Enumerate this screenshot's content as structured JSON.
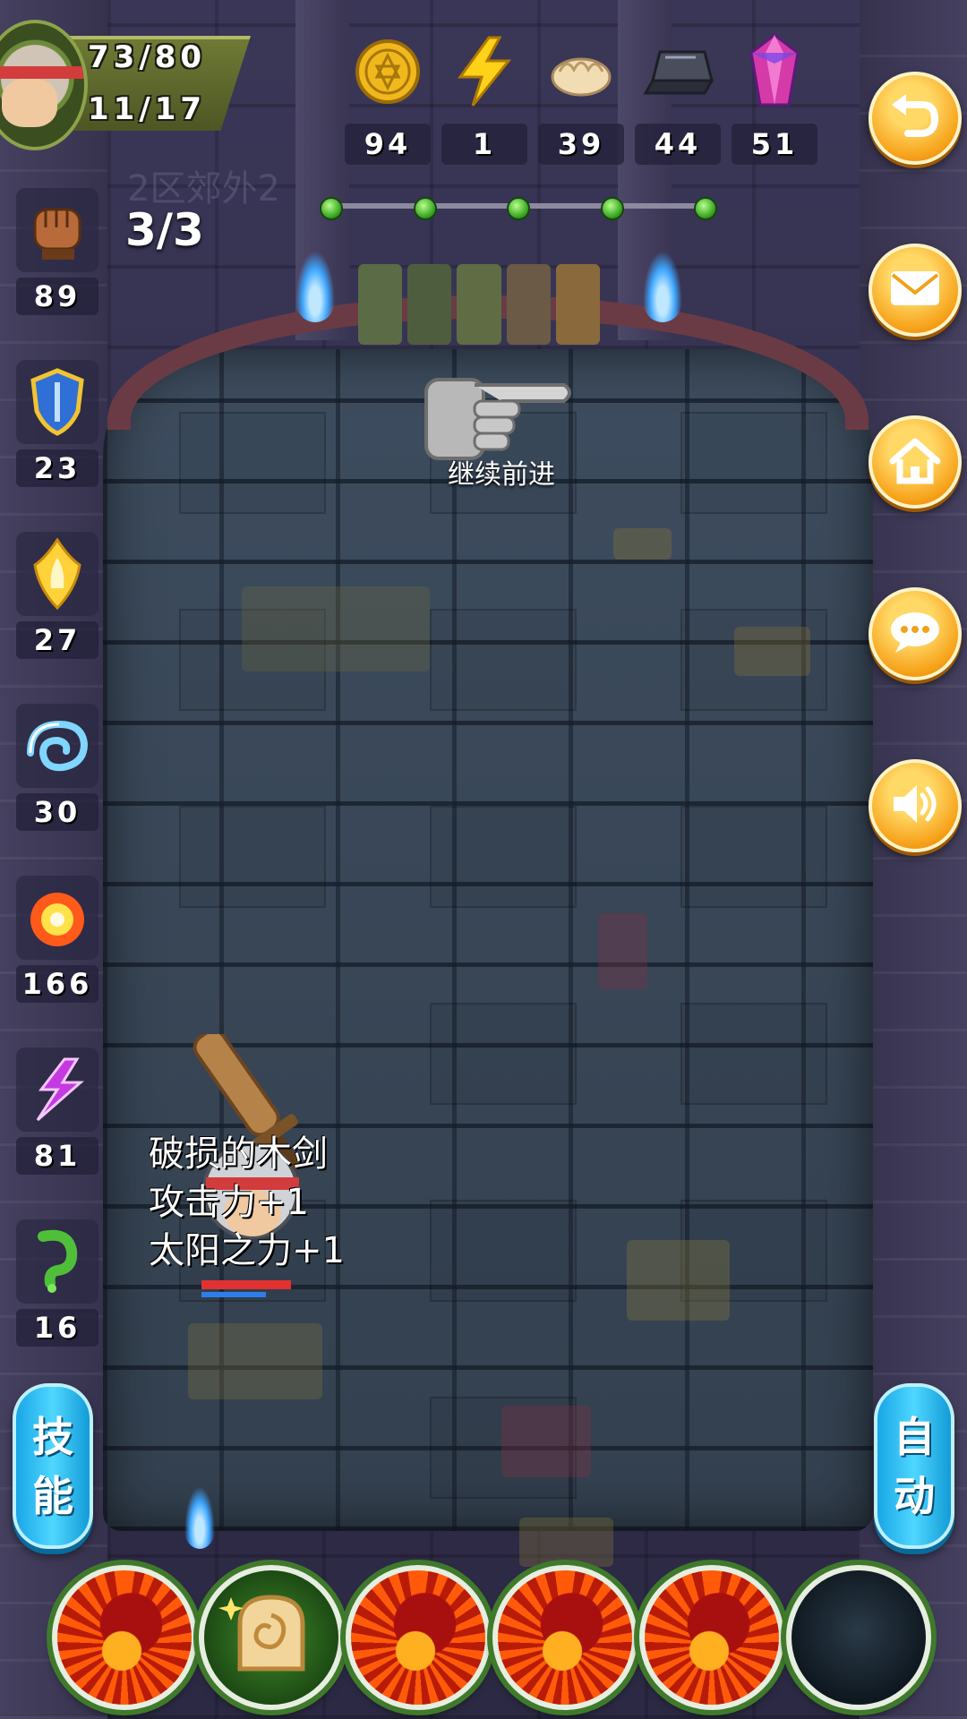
{
  "player": {
    "hp": "73/80",
    "level_progress": "11/17",
    "fist_count": "3/3"
  },
  "location_faded": "2区郊外2",
  "resources": [
    {
      "icon": "gold-coin-icon",
      "value": "94"
    },
    {
      "icon": "lightning-icon",
      "value": "1"
    },
    {
      "icon": "dumpling-icon",
      "value": "39"
    },
    {
      "icon": "iron-ingot-icon",
      "value": "44"
    },
    {
      "icon": "crystal-icon",
      "value": "51"
    }
  ],
  "stage_progress": {
    "total": 5,
    "completed": 5
  },
  "stats": [
    {
      "icon": "fist-icon",
      "value": "89"
    },
    {
      "icon": "shield-icon",
      "value": "23"
    },
    {
      "icon": "holy-flame-icon",
      "value": "27"
    },
    {
      "icon": "water-swirl-icon",
      "value": "30"
    },
    {
      "icon": "fire-sun-icon",
      "value": "166"
    },
    {
      "icon": "purple-lightning-icon",
      "value": "81"
    },
    {
      "icon": "green-poison-icon",
      "value": "16"
    }
  ],
  "side_buttons": [
    {
      "icon": "return-icon"
    },
    {
      "icon": "mail-icon"
    },
    {
      "icon": "home-icon"
    },
    {
      "icon": "chat-icon"
    },
    {
      "icon": "sound-icon"
    }
  ],
  "hint": "继续前进",
  "loot_popup": {
    "item": "破损的木剑",
    "line2": "攻击力+1",
    "line3": "太阳之力+1"
  },
  "hero": {
    "hp_fraction": 1.0,
    "mp_fraction": 0.72
  },
  "buttons": {
    "skill_char1": "技",
    "skill_char2": "能",
    "auto_char1": "自",
    "auto_char2": "动"
  },
  "skill_slots": [
    "fire-demon",
    "bread-roll",
    "fire-demon",
    "fire-demon",
    "fire-demon",
    "empty"
  ],
  "colors": {
    "accent_orange": "#f7a21a",
    "accent_blue": "#2fc4f5",
    "progress_green": "#2f9c1b"
  }
}
